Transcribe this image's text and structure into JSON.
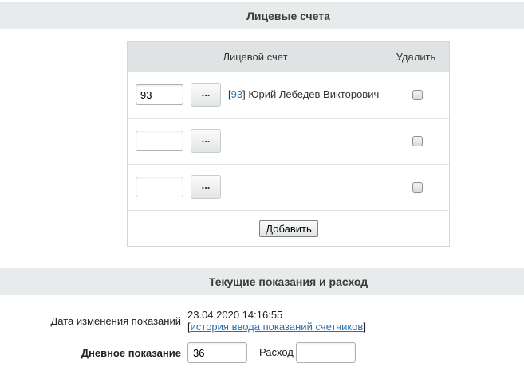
{
  "sections": {
    "accounts_title": "Лицевые счета",
    "readings_title": "Текущие показания и расход"
  },
  "accounts_table": {
    "col_account": "Лицевой счет",
    "col_delete": "Удалить",
    "rows": [
      {
        "value": "93",
        "button_label": "...",
        "link_text": "93",
        "owner": "Юрий Лебедев Викторович",
        "bracket_open": "[",
        "bracket_close": "]",
        "delete_checked": false
      },
      {
        "value": "",
        "button_label": "...",
        "delete_checked": false
      },
      {
        "value": "",
        "button_label": "...",
        "delete_checked": false
      }
    ],
    "add_button": "Добавить"
  },
  "readings": {
    "date_label": "Дата изменения показаний",
    "date_value": "23.04.2020 14:16:55",
    "history_bracket_open": "[",
    "history_link": "история ввода показаний счетчиков",
    "history_bracket_close": "]",
    "day_label": "Дневное показание",
    "day_value": "36",
    "consumption_label": "Расход",
    "consumption_value": ""
  },
  "colors": {
    "header_bg": "#e8ebeb",
    "link": "#2b6fb0"
  }
}
